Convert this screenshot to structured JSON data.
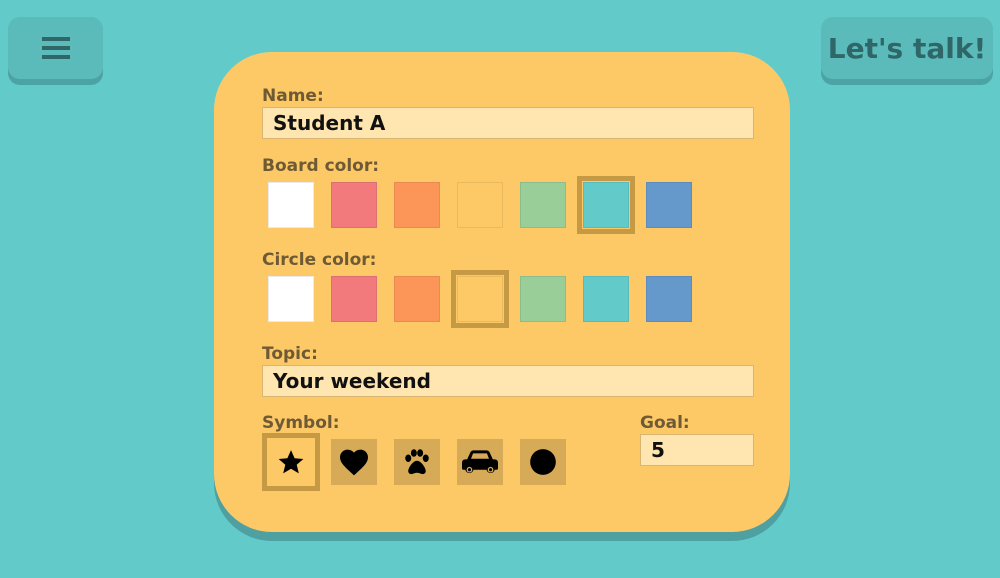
{
  "header": {
    "menu_icon": "hamburger-menu-icon",
    "talk_button_label": "Let's talk!"
  },
  "form": {
    "name": {
      "label": "Name:",
      "value": "Student A"
    },
    "board_color": {
      "label": "Board color:",
      "selected_index": 5,
      "swatches": [
        "#FFFFFF",
        "#F27A7C",
        "#FC9658",
        "#FDC967",
        "#9ACE98",
        "#62CBCA",
        "#6599CC"
      ]
    },
    "circle_color": {
      "label": "Circle color:",
      "selected_index": 3,
      "swatches": [
        "#FFFFFF",
        "#F27A7C",
        "#FC9658",
        "#FDC967",
        "#9ACE98",
        "#62CBCA",
        "#6599CC"
      ]
    },
    "topic": {
      "label": "Topic:",
      "value": "Your weekend"
    },
    "symbol": {
      "label": "Symbol:",
      "selected_index": 0,
      "options": [
        "star-icon",
        "heart-icon",
        "paw-icon",
        "car-icon",
        "circle-icon"
      ]
    },
    "goal": {
      "label": "Goal:",
      "value": "5"
    }
  },
  "colors": {
    "background": "#62CBCA",
    "card": "#FDC967",
    "input": "#FFE5AF",
    "label_text": "#6E5A34",
    "selection_border": "#C69A44"
  }
}
